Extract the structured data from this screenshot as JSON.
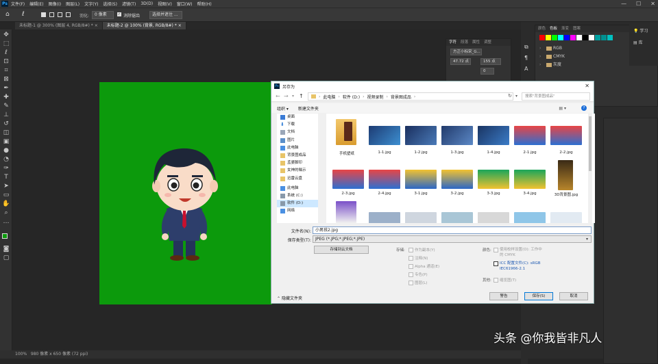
{
  "app": {
    "menu": [
      "文件(F)",
      "编辑(E)",
      "图像(I)",
      "图层(L)",
      "文字(Y)",
      "选择(S)",
      "滤镜(T)",
      "3D(D)",
      "视图(V)",
      "窗口(W)",
      "帮助(H)"
    ],
    "window_controls": [
      "—",
      "☐",
      "✕"
    ]
  },
  "options": {
    "feather_label": "羽化:",
    "feather_value": "0 像素",
    "antialias": "消除锯齿",
    "select_mask": "选择并遮住 ..."
  },
  "tabs": [
    {
      "label": "未标题-1 @ 300% (图层 4, RGB/8#) *  ×"
    },
    {
      "label": "未标题-2 @ 100% (背景, RGB/8#) *  ×"
    }
  ],
  "status": {
    "zoom": "100%",
    "doc_info": "980 像素 x 650 像素 (72 ppi)"
  },
  "right": {
    "char_tabs": [
      "字符",
      "段落",
      "属性",
      "调整"
    ],
    "font_name": "方正小标宋_G...",
    "font_size": "47.72 点",
    "leading": "155 点",
    "tracking": "0",
    "swatch_tabs": [
      "颜色",
      "色板",
      "渐变",
      "图案"
    ],
    "swatch_colors": [
      "#ff0000",
      "#ffff00",
      "#00ff00",
      "#00ffff",
      "#0000ff",
      "#ff00ff",
      "#ffffff",
      "#000000",
      "#ffffff",
      "#00a0a0",
      "#009090",
      "#00c0c0"
    ],
    "groups": [
      "RGB",
      "CMYK",
      "灰度"
    ],
    "learn_label": "学习",
    "lib_label": "库"
  },
  "dialog": {
    "title": "另存为",
    "close": "✕",
    "address": [
      "此电脑",
      "软件 (D:)",
      "视频录制",
      "背景图成品"
    ],
    "search_placeholder": "搜索\"背景图成品\"",
    "organize": "组织 ▾",
    "new_folder": "新建文件夹",
    "nav_items": [
      "桌面",
      "下载",
      "文档",
      "图片",
      "此电脑",
      "背景图成品",
      "孟婆脚印",
      "女神的嘱示",
      "迅雷云盘",
      "此电脑",
      "系统 (C:)",
      "软件 (D:)",
      "网络"
    ],
    "files_row1": [
      "手机壁纸",
      "1-1.jpg",
      "1-2.jpg",
      "1-3.jpg",
      "1-4.jpg",
      "2-1.jpg",
      "2-2.jpg"
    ],
    "files_row2": [
      "2-3.jpg",
      "2-4.jpg",
      "3-1.jpg",
      "3-2.jpg",
      "3-3.jpg",
      "3-4.jpg",
      "3D背景图.jpg"
    ],
    "filename_label": "文件名(N):",
    "filename_value": "小男孩2.jpg",
    "filetype_label": "保存类型(T):",
    "filetype_value": "JPEG (*.JPG;*.JPEG;*.JPE)",
    "cloud_btn": "存储到云文档",
    "save_label": "存储:",
    "opts": [
      "作为副本(Y)",
      "注释(N)",
      "Alpha 通道(E)",
      "专色(P)",
      "图层(L)"
    ],
    "color_label": "颜色:",
    "proof": "使用校样设置(O): 工作中的 CMYK",
    "icc": "ICC 配置文件(C): sRGB IEC61966-2.1",
    "other_label": "其他:",
    "thumbnail": "缩览图(T)",
    "hide_folders": "隐藏文件夹",
    "warning": "警告",
    "save": "保存(S)",
    "cancel": "取消"
  },
  "watermark": "头条 @你我皆非凡人"
}
